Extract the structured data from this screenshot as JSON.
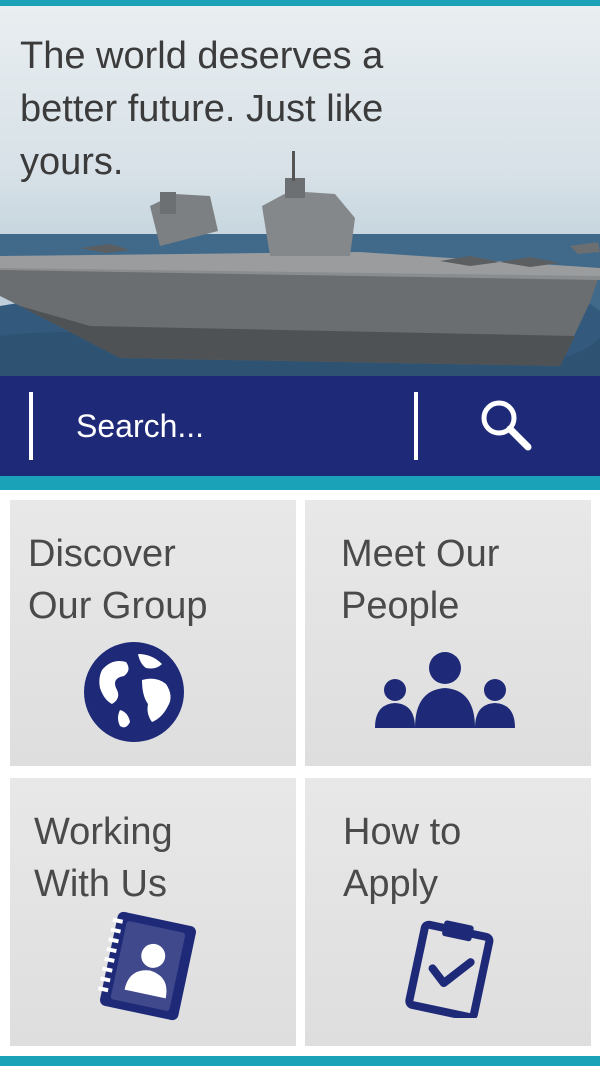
{
  "hero": {
    "headline": "The world deserves a better future. Just like yours."
  },
  "search": {
    "placeholder": "Search..."
  },
  "tiles": [
    {
      "label": "Discover\nOur Group",
      "icon": "globe-icon"
    },
    {
      "label": "Meet Our\nPeople",
      "icon": "people-icon"
    },
    {
      "label": "Working\nWith Us",
      "icon": "contact-book-icon"
    },
    {
      "label": "How to\nApply",
      "icon": "clipboard-check-icon"
    }
  ],
  "colors": {
    "brand_navy": "#1e2a78",
    "accent_teal": "#1aa3b8",
    "tile_bg": "#e3e3e3",
    "text_dark": "#4a4a4a"
  }
}
